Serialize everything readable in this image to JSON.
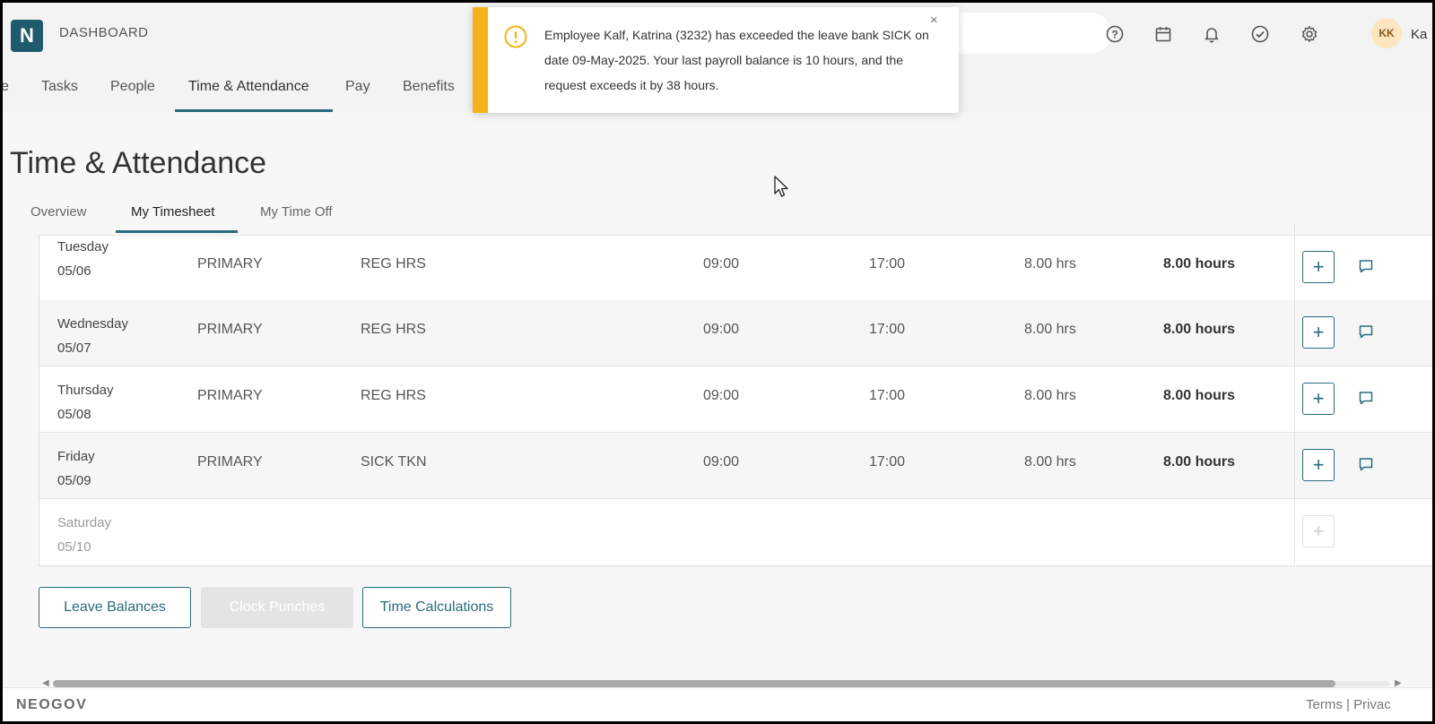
{
  "topbar": {
    "logo_letter": "N",
    "dashboard_label": "DASHBOARD",
    "icons": [
      "help-icon",
      "calendar-icon",
      "bell-icon",
      "check-circle-icon",
      "gear-icon"
    ],
    "avatar_initials": "KK",
    "user_name_partial": "Ka"
  },
  "main_nav": {
    "items": [
      "e",
      "Tasks",
      "People",
      "Time & Attendance",
      "Pay",
      "Benefits"
    ],
    "active": "Time & Attendance"
  },
  "toast": {
    "type": "warning",
    "message": "Employee Kalf, Katrina (3232) has exceeded the leave bank SICK on date 09-May-2025. Your last payroll balance is 10 hours, and the request exceeds it by 38 hours.",
    "close": "×"
  },
  "page": {
    "title": "Time & Attendance",
    "subtabs": [
      "Overview",
      "My Timesheet",
      "My Time Off"
    ],
    "active_subtab": "My Timesheet"
  },
  "timesheet": {
    "rows": [
      {
        "day": "Tuesday",
        "date": "05/06",
        "position": "PRIMARY",
        "earning": "REG HRS",
        "time_in": "09:00",
        "time_out": "17:00",
        "hours": "8.00 hrs",
        "total": "8.00 hours"
      },
      {
        "day": "Wednesday",
        "date": "05/07",
        "position": "PRIMARY",
        "earning": "REG HRS",
        "time_in": "09:00",
        "time_out": "17:00",
        "hours": "8.00 hrs",
        "total": "8.00 hours"
      },
      {
        "day": "Thursday",
        "date": "05/08",
        "position": "PRIMARY",
        "earning": "REG HRS",
        "time_in": "09:00",
        "time_out": "17:00",
        "hours": "8.00 hrs",
        "total": "8.00 hours"
      },
      {
        "day": "Friday",
        "date": "05/09",
        "position": "PRIMARY",
        "earning": "SICK TKN",
        "time_in": "09:00",
        "time_out": "17:00",
        "hours": "8.00 hrs",
        "total": "8.00 hours"
      },
      {
        "day": "Saturday",
        "date": "05/10",
        "position": "",
        "earning": "",
        "time_in": "",
        "time_out": "",
        "hours": "",
        "total": ""
      }
    ],
    "add_label": "+"
  },
  "buttons": {
    "leave_balances": "Leave Balances",
    "clock_punches": "Clock Punches",
    "time_calculations": "Time Calculations"
  },
  "footer": {
    "brand": "NEOGOV",
    "links": "Terms | Privac"
  },
  "colors": {
    "accent": "#2a6b7c",
    "warning": "#f5b21b"
  }
}
